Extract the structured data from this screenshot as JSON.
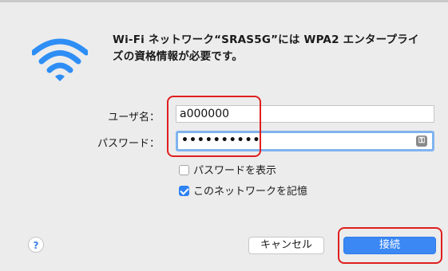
{
  "dialog": {
    "message_line1": "Wi-Fi ネットワーク“SRAS5G”には WPA2 エンタープライ",
    "message_line2": "ズの資格情報が必要です。"
  },
  "form": {
    "username_label": "ユーザ名：",
    "username_value": "a000000",
    "password_label": "パスワード：",
    "password_value": "••••••••••"
  },
  "options": {
    "show_password_label": "パスワードを表示",
    "show_password_checked": false,
    "remember_network_label": "このネットワークを記憶",
    "remember_network_checked": true
  },
  "buttons": {
    "help_label": "?",
    "cancel_label": "キャンセル",
    "connect_label": "接続"
  },
  "colors": {
    "accent": "#3b88f5",
    "highlight": "#e01e1e",
    "wifi_icon": "#2e8ef5"
  },
  "icons": {
    "wifi": "wifi-icon",
    "key": "key-icon"
  }
}
